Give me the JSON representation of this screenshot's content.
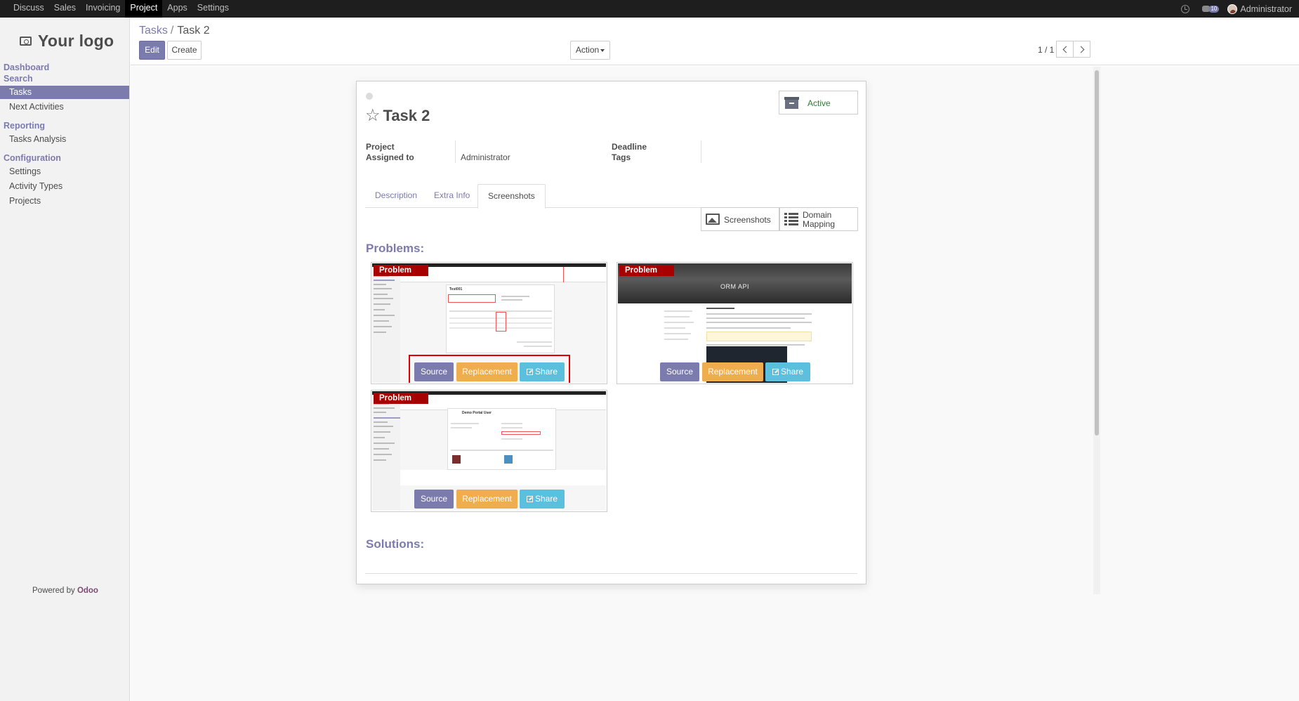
{
  "topbar": {
    "menu": [
      "Discuss",
      "Sales",
      "Invoicing",
      "Project",
      "Apps",
      "Settings"
    ],
    "active_menu": "Project",
    "messages_badge": "10",
    "user_name": "Administrator"
  },
  "sidebar": {
    "logo_text": "Your logo",
    "sections": {
      "dashboard": "Dashboard",
      "search": "Search",
      "reporting": "Reporting",
      "configuration": "Configuration"
    },
    "items": {
      "tasks": "Tasks",
      "next_activities": "Next Activities",
      "tasks_analysis": "Tasks Analysis",
      "settings": "Settings",
      "activity_types": "Activity Types",
      "projects": "Projects"
    },
    "powered_prefix": "Powered by ",
    "powered_brand": "Odoo"
  },
  "control": {
    "breadcrumb_parent": "Tasks",
    "breadcrumb_sep": "/",
    "breadcrumb_current": "Task 2",
    "edit_label": "Edit",
    "create_label": "Create",
    "action_label": "Action",
    "pager": "1 / 1"
  },
  "form": {
    "active_label": "Active",
    "title": "Task 2",
    "labels": {
      "project": "Project",
      "assigned_to": "Assigned to",
      "deadline": "Deadline",
      "tags": "Tags"
    },
    "values": {
      "assigned_to": "Administrator"
    },
    "tabs": [
      "Description",
      "Extra Info",
      "Screenshots"
    ],
    "active_tab": "Screenshots",
    "stat_buttons": {
      "screenshots": "Screenshots",
      "domain_mapping_1": "Domain",
      "domain_mapping_2": "Mapping"
    },
    "problems_title": "Problems:",
    "solutions_title": "Solutions:",
    "cards": [
      {
        "ribbon": "Problem",
        "source": "Source",
        "replacement": "Replacement",
        "share": "Share",
        "mini_title": "Test001"
      },
      {
        "ribbon": "Problem",
        "source": "Source",
        "replacement": "Replacement",
        "share": "Share",
        "mini_title": "ORM API"
      },
      {
        "ribbon": "Problem",
        "source": "Source",
        "replacement": "Replacement",
        "share": "Share",
        "mini_title": "Demo Portal User"
      }
    ]
  },
  "colors": {
    "brand": "#7c7bad",
    "problem_ribbon": "#a60000",
    "replacement": "#f0ad4e",
    "share": "#5bc0de",
    "highlight": "#e00000",
    "active_status": "#2e7d32"
  }
}
